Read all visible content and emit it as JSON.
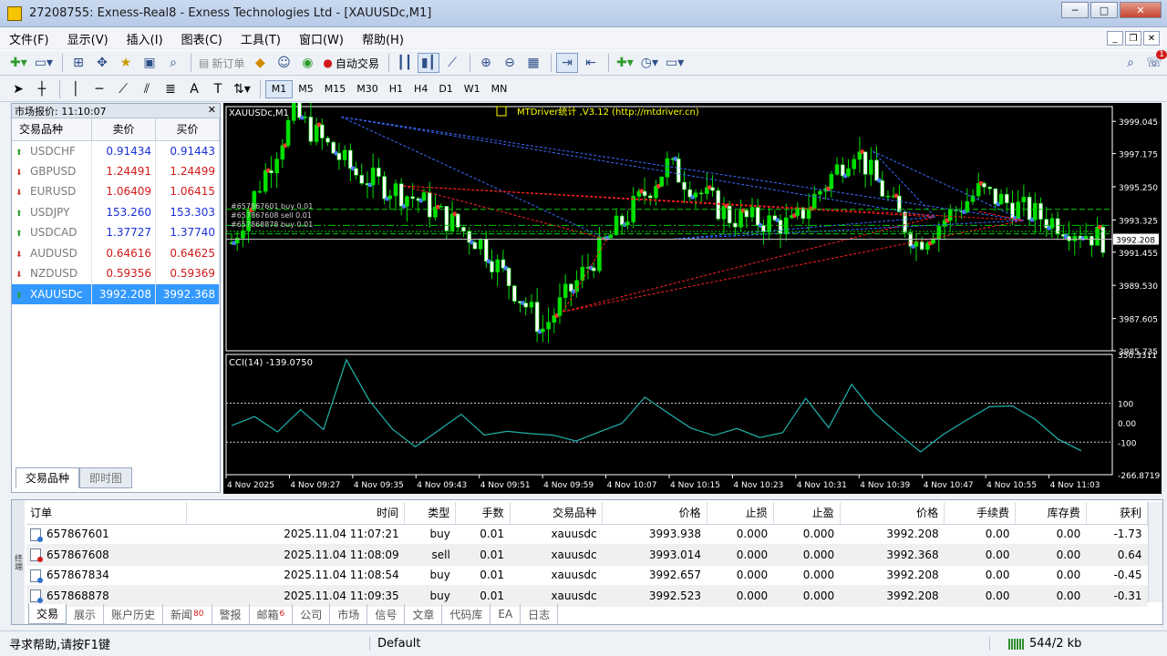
{
  "window": {
    "title": "27208755: Exness-Real8 - Exness Technologies Ltd - [XAUUSDc,M1]"
  },
  "menu": [
    "文件(F)",
    "显示(V)",
    "插入(I)",
    "图表(C)",
    "工具(T)",
    "窗口(W)",
    "帮助(H)"
  ],
  "toolbar": {
    "new_order": "新订单",
    "auto_trade": "自动交易",
    "timeframes": [
      "M1",
      "M5",
      "M15",
      "M30",
      "H1",
      "H4",
      "D1",
      "W1",
      "MN"
    ],
    "active_tf": "M1",
    "alert_count": "1"
  },
  "market_watch": {
    "header": "市场报价: 11:10:07",
    "columns": [
      "交易品种",
      "卖价",
      "买价"
    ],
    "rows": [
      {
        "symbol": "USDCHF",
        "bid": "0.91434",
        "ask": "0.91443",
        "dir": "up",
        "color": "blue"
      },
      {
        "symbol": "GBPUSD",
        "bid": "1.24491",
        "ask": "1.24499",
        "dir": "dn",
        "color": "red"
      },
      {
        "symbol": "EURUSD",
        "bid": "1.06409",
        "ask": "1.06415",
        "dir": "dn",
        "color": "red"
      },
      {
        "symbol": "USDJPY",
        "bid": "153.260",
        "ask": "153.303",
        "dir": "up",
        "color": "blue"
      },
      {
        "symbol": "USDCAD",
        "bid": "1.37727",
        "ask": "1.37740",
        "dir": "up",
        "color": "blue"
      },
      {
        "symbol": "AUDUSD",
        "bid": "0.64616",
        "ask": "0.64625",
        "dir": "dn",
        "color": "red"
      },
      {
        "symbol": "NZDUSD",
        "bid": "0.59356",
        "ask": "0.59369",
        "dir": "dn",
        "color": "red"
      },
      {
        "symbol": "XAUUSDc",
        "bid": "3992.208",
        "ask": "3992.368",
        "dir": "up",
        "color": "blue"
      }
    ],
    "tabs": [
      "交易品种",
      "即时图"
    ]
  },
  "chart": {
    "symbol_label": "XAUUSDc,M1",
    "indicator_label": "MTDriver统计 ,V3.12 (http://mtdriver.cn)",
    "order_labels": [
      "#657867601 buy 0.01",
      "#657867608 sell 0.01",
      "#657868878 buy 0.01"
    ],
    "price_ticks": [
      "3999.045",
      "3997.175",
      "3995.250",
      "3993.325",
      "3991.455",
      "3989.530",
      "3987.605",
      "3985.735"
    ],
    "current_price": "3992.208",
    "cci_label": "CCI(14) -139.0750",
    "cci_ticks": [
      "350.3311",
      "100",
      "0.00",
      "-100",
      "-266.8719"
    ],
    "time_ticks": [
      "4 Nov 2025",
      "4 Nov 09:27",
      "4 Nov 09:35",
      "4 Nov 09:43",
      "4 Nov 09:51",
      "4 Nov 09:59",
      "4 Nov 10:07",
      "4 Nov 10:15",
      "4 Nov 10:23",
      "4 Nov 10:31",
      "4 Nov 10:39",
      "4 Nov 10:47",
      "4 Nov 10:55",
      "4 Nov 11:03"
    ],
    "colors": {
      "bull": "#00e000",
      "bear": "#ffffff",
      "grid": "#1aa81a",
      "buy_line": "#3a6cff",
      "sell_line": "#ff2020",
      "cci": "#20b2aa"
    }
  },
  "chart_data": {
    "type": "line",
    "title": "XAUUSDc,M1",
    "x": [
      "09:19",
      "09:27",
      "09:35",
      "09:43",
      "09:51",
      "09:59",
      "10:07",
      "10:15",
      "10:23",
      "10:31",
      "10:39",
      "10:47",
      "10:55",
      "11:03",
      "11:06"
    ],
    "series": [
      {
        "values": [
          3992.0,
          3999.5,
          3996.0,
          3994.5,
          3992.0,
          3987.0,
          3992.0,
          3996.5,
          3993.5,
          3993.0,
          3997.5,
          3992.0,
          3995.0,
          3993.5,
          3992.2
        ]
      }
    ],
    "ylim": [
      3985.735,
      3999.9
    ]
  },
  "terminal": {
    "columns": [
      "订单",
      "时间",
      "类型",
      "手数",
      "交易品种",
      "价格",
      "止损",
      "止盈",
      "价格",
      "手续费",
      "库存费",
      "获利"
    ],
    "rows": [
      [
        "657867601",
        "2025.11.04 11:07:21",
        "buy",
        "0.01",
        "xauusdc",
        "3993.938",
        "0.000",
        "0.000",
        "3992.208",
        "0.00",
        "0.00",
        "-1.73"
      ],
      [
        "657867608",
        "2025.11.04 11:08:09",
        "sell",
        "0.01",
        "xauusdc",
        "3993.014",
        "0.000",
        "0.000",
        "3992.368",
        "0.00",
        "0.00",
        "0.64"
      ],
      [
        "657867834",
        "2025.11.04 11:08:54",
        "buy",
        "0.01",
        "xauusdc",
        "3992.657",
        "0.000",
        "0.000",
        "3992.208",
        "0.00",
        "0.00",
        "-0.45"
      ],
      [
        "657868878",
        "2025.11.04 11:09:35",
        "buy",
        "0.01",
        "xauusdc",
        "3992.523",
        "0.000",
        "0.000",
        "3992.208",
        "0.00",
        "0.00",
        "-0.31"
      ]
    ],
    "tabs": [
      {
        "label": "交易"
      },
      {
        "label": "展示"
      },
      {
        "label": "账户历史"
      },
      {
        "label": "新闻",
        "count": "80"
      },
      {
        "label": "警报"
      },
      {
        "label": "邮箱",
        "count": "6"
      },
      {
        "label": "公司"
      },
      {
        "label": "市场"
      },
      {
        "label": "信号"
      },
      {
        "label": "文章"
      },
      {
        "label": "代码库"
      },
      {
        "label": "EA"
      },
      {
        "label": "日志"
      }
    ],
    "side_label": "终端"
  },
  "status": {
    "help": "寻求帮助,请按F1键",
    "profile": "Default",
    "traffic": "544/2 kb"
  }
}
